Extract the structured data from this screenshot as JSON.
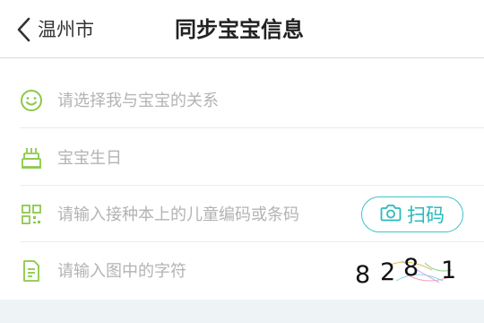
{
  "header": {
    "back_label": "温州市",
    "title": "同步宝宝信息"
  },
  "form": {
    "relation_placeholder": "请选择我与宝宝的关系",
    "birthday_placeholder": "宝宝生日",
    "code_placeholder": "请输入接种本上的儿童编码或条码",
    "scan_label": "扫码",
    "captcha_placeholder": "请输入图中的字符",
    "captcha_chars": [
      "8",
      "2",
      "8",
      "1"
    ]
  },
  "colors": {
    "icon_green": "#8cc84b",
    "accent_teal": "#2ab9bb",
    "placeholder_gray": "#b3b3b3"
  },
  "icons": {
    "back": "chevron-left-icon",
    "relation": "smiley-face-icon",
    "birthday": "birthday-cake-icon",
    "code": "qr-code-icon",
    "captcha": "document-icon",
    "scan": "camera-icon"
  }
}
